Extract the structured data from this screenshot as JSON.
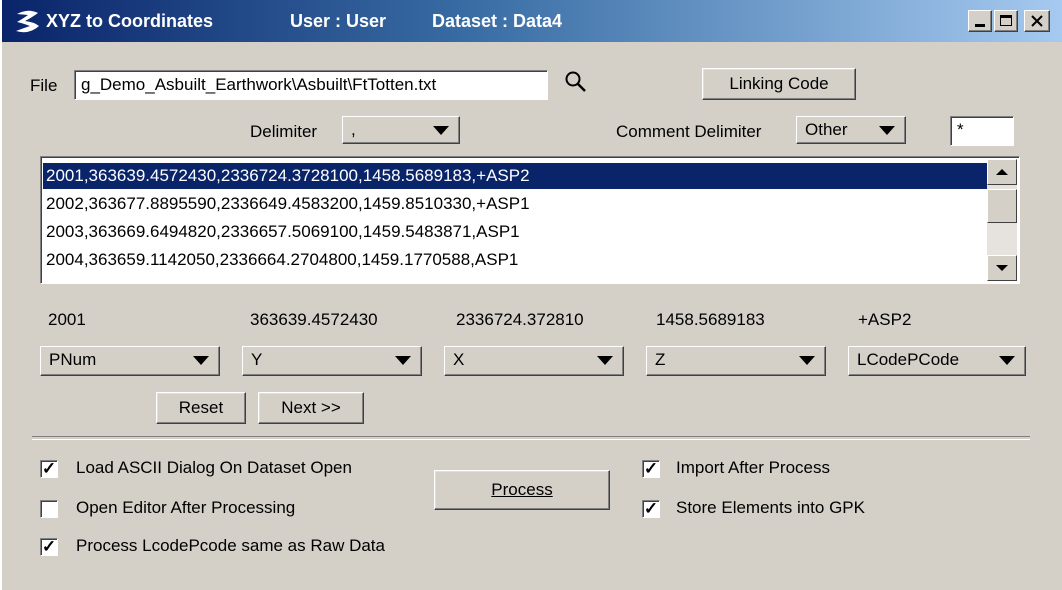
{
  "window": {
    "title": "XYZ to Coordinates",
    "user_label": "User : User",
    "dataset_label": "Dataset : Data4"
  },
  "file": {
    "label": "File",
    "value": "g_Demo_Asbuilt_Earthwork\\Asbuilt\\FtTotten.txt",
    "search_icon": "magnifier-icon",
    "linking_code_button": "Linking Code"
  },
  "delimiter": {
    "label": "Delimiter",
    "value": ","
  },
  "comment_delimiter": {
    "label": "Comment Delimiter",
    "value": "Other",
    "custom_value": "*"
  },
  "data_lines": [
    "2001,363639.4572430,2336724.3728100,1458.5689183,+ASP2",
    "2002,363677.8895590,2336649.4583200,1459.8510330,+ASP1",
    "2003,363669.6494820,2336657.5069100,1459.5483871,ASP1",
    "2004,363659.1142050,2336664.2704800,1459.1770588,ASP1"
  ],
  "columns": [
    {
      "preview": "2001",
      "field": "PNum"
    },
    {
      "preview": "363639.4572430",
      "field": "Y"
    },
    {
      "preview": "2336724.372810",
      "field": "X"
    },
    {
      "preview": "1458.5689183",
      "field": "Z"
    },
    {
      "preview": "+ASP2",
      "field": "LCodePCode"
    }
  ],
  "buttons": {
    "reset": "Reset",
    "next": "Next >>",
    "process": "Process"
  },
  "options": {
    "load_ascii_dialog": {
      "label": "Load ASCII Dialog On Dataset Open",
      "checked": true
    },
    "open_editor": {
      "label": "Open Editor After Processing",
      "checked": false
    },
    "process_lcode": {
      "label": "Process LcodePcode same as Raw Data",
      "checked": true
    },
    "import_after": {
      "label": "Import After Process",
      "checked": true
    },
    "store_elements": {
      "label": "Store Elements into GPK",
      "checked": true
    }
  },
  "colors": {
    "title_start": "#0a246a",
    "title_end": "#a6caf0",
    "selection": "#0a246a",
    "face": "#d4d0c8"
  }
}
